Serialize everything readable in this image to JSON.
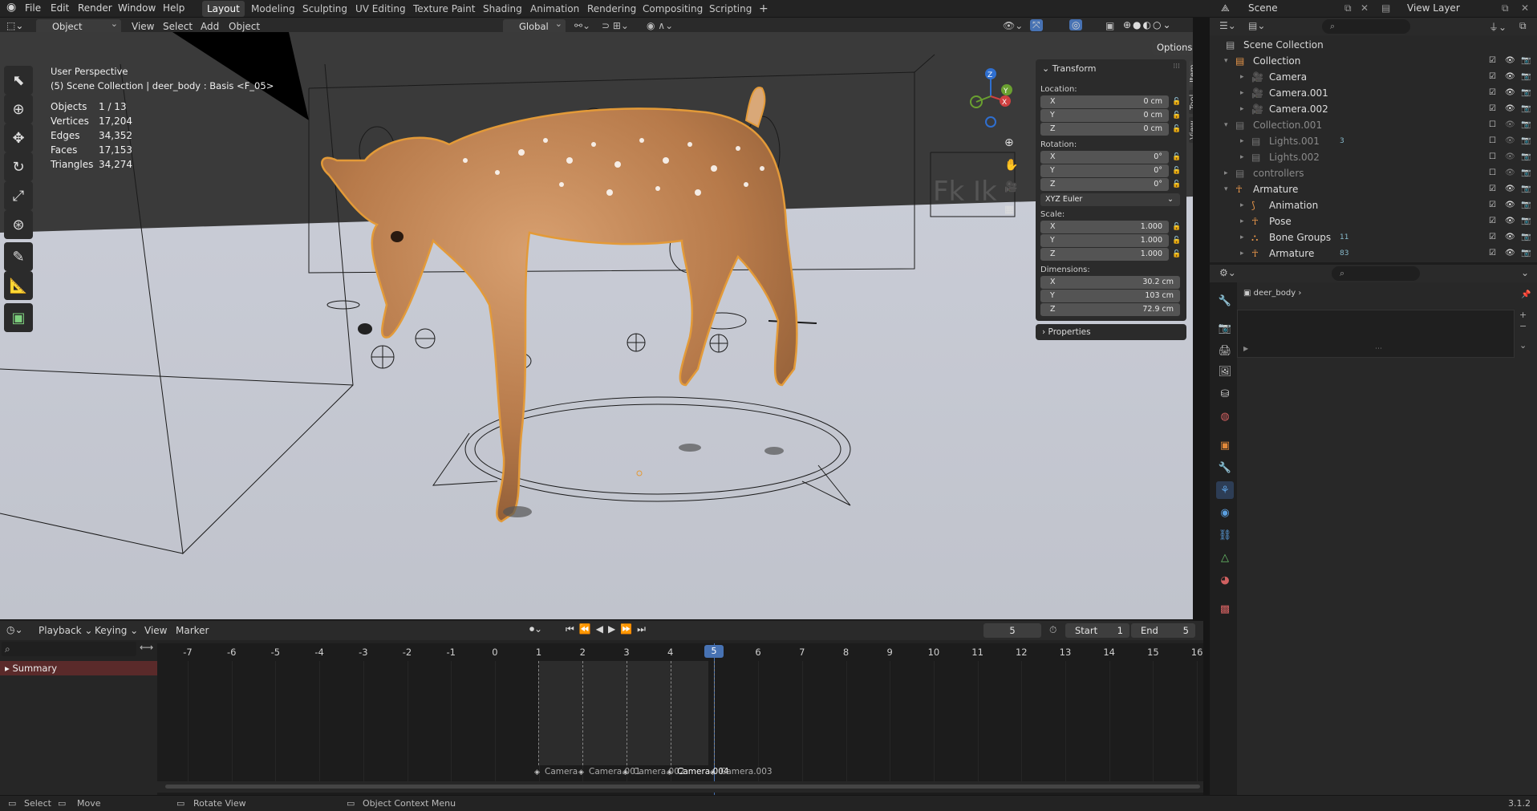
{
  "topbar": {
    "menus": [
      "File",
      "Edit",
      "Render",
      "Window",
      "Help"
    ],
    "workspaces": [
      "Layout",
      "Modeling",
      "Sculpting",
      "UV Editing",
      "Texture Paint",
      "Shading",
      "Animation",
      "Rendering",
      "Compositing",
      "Scripting"
    ],
    "active_workspace": "Layout",
    "add_tab": "+",
    "scene": "Scene",
    "view_layer": "View Layer"
  },
  "viewport_header": {
    "mode": "Object Mode",
    "menus": [
      "View",
      "Select",
      "Add",
      "Object"
    ],
    "orientation": "Global",
    "options": "Options"
  },
  "overlay": {
    "title": "User Perspective",
    "subtitle": "(5) Scene Collection | deer_body : Basis <F_05>",
    "stats": [
      {
        "label": "Objects",
        "value": "1 / 13"
      },
      {
        "label": "Vertices",
        "value": "17,204"
      },
      {
        "label": "Edges",
        "value": "34,352"
      },
      {
        "label": "Faces",
        "value": "17,153"
      },
      {
        "label": "Triangles",
        "value": "34,274"
      }
    ],
    "rig_label": "Fk  Ik"
  },
  "npanel": {
    "section": "Transform",
    "location_label": "Location:",
    "location": [
      {
        "axis": "X",
        "value": "0 cm"
      },
      {
        "axis": "Y",
        "value": "0 cm"
      },
      {
        "axis": "Z",
        "value": "0 cm"
      }
    ],
    "rotation_label": "Rotation:",
    "rotation": [
      {
        "axis": "X",
        "value": "0°"
      },
      {
        "axis": "Y",
        "value": "0°"
      },
      {
        "axis": "Z",
        "value": "0°"
      }
    ],
    "rotation_mode": "XYZ Euler",
    "scale_label": "Scale:",
    "scale": [
      {
        "axis": "X",
        "value": "1.000"
      },
      {
        "axis": "Y",
        "value": "1.000"
      },
      {
        "axis": "Z",
        "value": "1.000"
      }
    ],
    "dimensions_label": "Dimensions:",
    "dimensions": [
      {
        "axis": "X",
        "value": "30.2 cm"
      },
      {
        "axis": "Y",
        "value": "103 cm"
      },
      {
        "axis": "Z",
        "value": "72.9 cm"
      }
    ],
    "properties_section": "Properties",
    "tabs": [
      "Item",
      "Tool",
      "View"
    ]
  },
  "gizmo": {
    "x": "X",
    "y": "Y",
    "z": "Z"
  },
  "outliner": {
    "root": "Scene Collection",
    "rows": [
      {
        "label": "Collection",
        "indent": 1,
        "expanded": true,
        "dim": false
      },
      {
        "label": "Camera",
        "indent": 2,
        "dim": false
      },
      {
        "label": "Camera.001",
        "indent": 2,
        "dim": false
      },
      {
        "label": "Camera.002",
        "indent": 2,
        "dim": false
      },
      {
        "label": "Collection.001",
        "indent": 1,
        "expanded": true,
        "dim": true
      },
      {
        "label": "Lights.001",
        "indent": 2,
        "dim": true,
        "badge": "3"
      },
      {
        "label": "Lights.002",
        "indent": 2,
        "dim": true
      },
      {
        "label": "controllers",
        "indent": 1,
        "dim": true
      },
      {
        "label": "Armature",
        "indent": 1,
        "expanded": true,
        "dim": false
      },
      {
        "label": "Animation",
        "indent": 2,
        "dim": false
      },
      {
        "label": "Pose",
        "indent": 2,
        "dim": false
      },
      {
        "label": "Bone Groups",
        "indent": 2,
        "dim": false,
        "badge": "11"
      },
      {
        "label": "Armature",
        "indent": 2,
        "dim": false,
        "badge": "83"
      }
    ]
  },
  "properties": {
    "breadcrumb": "deer_body"
  },
  "timeline": {
    "menus": [
      "Playback",
      "Keying",
      "View",
      "Marker"
    ],
    "current_frame": "5",
    "start_label": "Start",
    "start": "1",
    "end_label": "End",
    "end": "5",
    "ruler": [
      "-7",
      "-6",
      "-5",
      "-4",
      "-3",
      "-2",
      "-1",
      "0",
      "1",
      "2",
      "3",
      "4",
      "5",
      "6",
      "7",
      "8",
      "9",
      "10",
      "11",
      "12",
      "13",
      "14",
      "15",
      "16"
    ],
    "summary": "Summary",
    "markers": [
      "Camera",
      "Camera.001",
      "Camera.002",
      "Camera.004",
      "Camera.003"
    ]
  },
  "statusbar": {
    "items": [
      "Select",
      "Move",
      "Rotate View",
      "Object Context Menu"
    ],
    "version": "3.1.2"
  },
  "colors": {
    "accent": "#4772b3",
    "selection_orange": "#f0a030",
    "summary_bg": "#5a2a2a"
  }
}
